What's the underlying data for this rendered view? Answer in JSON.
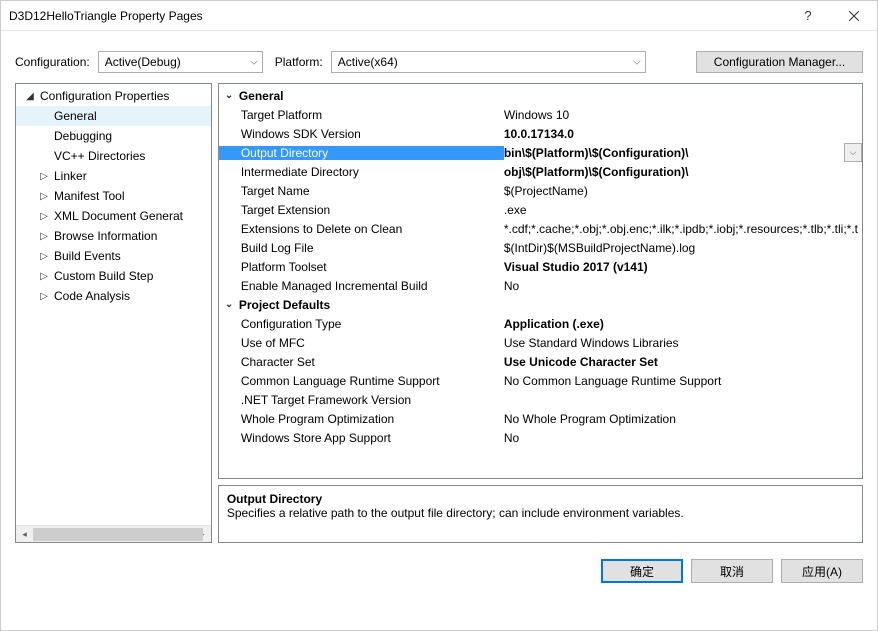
{
  "window": {
    "title": "D3D12HelloTriangle Property Pages"
  },
  "toolbar": {
    "configuration_label": "Configuration:",
    "configuration_value": "Active(Debug)",
    "platform_label": "Platform:",
    "platform_value": "Active(x64)",
    "config_manager_label": "Configuration Manager..."
  },
  "tree": {
    "root": "Configuration Properties",
    "items": [
      {
        "label": "General",
        "selected": true
      },
      {
        "label": "Debugging"
      },
      {
        "label": "VC++ Directories"
      },
      {
        "label": "Linker",
        "expandable": true
      },
      {
        "label": "Manifest Tool",
        "expandable": true
      },
      {
        "label": "XML Document Generat",
        "expandable": true
      },
      {
        "label": "Browse Information",
        "expandable": true
      },
      {
        "label": "Build Events",
        "expandable": true
      },
      {
        "label": "Custom Build Step",
        "expandable": true
      },
      {
        "label": "Code Analysis",
        "expandable": true
      }
    ]
  },
  "sections": [
    {
      "title": "General",
      "rows": [
        {
          "name": "Target Platform",
          "value": "Windows 10"
        },
        {
          "name": "Windows SDK Version",
          "value": "10.0.17134.0",
          "bold": true
        },
        {
          "name": "Output Directory",
          "value": "bin\\$(Platform)\\$(Configuration)\\",
          "bold": true,
          "selected": true
        },
        {
          "name": "Intermediate Directory",
          "value": "obj\\$(Platform)\\$(Configuration)\\",
          "bold": true
        },
        {
          "name": "Target Name",
          "value": "$(ProjectName)"
        },
        {
          "name": "Target Extension",
          "value": ".exe"
        },
        {
          "name": "Extensions to Delete on Clean",
          "value": "*.cdf;*.cache;*.obj;*.obj.enc;*.ilk;*.ipdb;*.iobj;*.resources;*.tlb;*.tli;*.t"
        },
        {
          "name": "Build Log File",
          "value": "$(IntDir)$(MSBuildProjectName).log"
        },
        {
          "name": "Platform Toolset",
          "value": "Visual Studio 2017 (v141)",
          "bold": true
        },
        {
          "name": "Enable Managed Incremental Build",
          "value": "No"
        }
      ]
    },
    {
      "title": "Project Defaults",
      "rows": [
        {
          "name": "Configuration Type",
          "value": "Application (.exe)",
          "bold": true
        },
        {
          "name": "Use of MFC",
          "value": "Use Standard Windows Libraries"
        },
        {
          "name": "Character Set",
          "value": "Use Unicode Character Set",
          "bold": true
        },
        {
          "name": "Common Language Runtime Support",
          "value": "No Common Language Runtime Support"
        },
        {
          "name": ".NET Target Framework Version",
          "value": ""
        },
        {
          "name": "Whole Program Optimization",
          "value": "No Whole Program Optimization"
        },
        {
          "name": "Windows Store App Support",
          "value": "No"
        }
      ]
    }
  ],
  "description": {
    "title": "Output Directory",
    "text": "Specifies a relative path to the output file directory; can include environment variables."
  },
  "buttons": {
    "ok": "确定",
    "cancel": "取消",
    "apply": "应用(A)"
  }
}
